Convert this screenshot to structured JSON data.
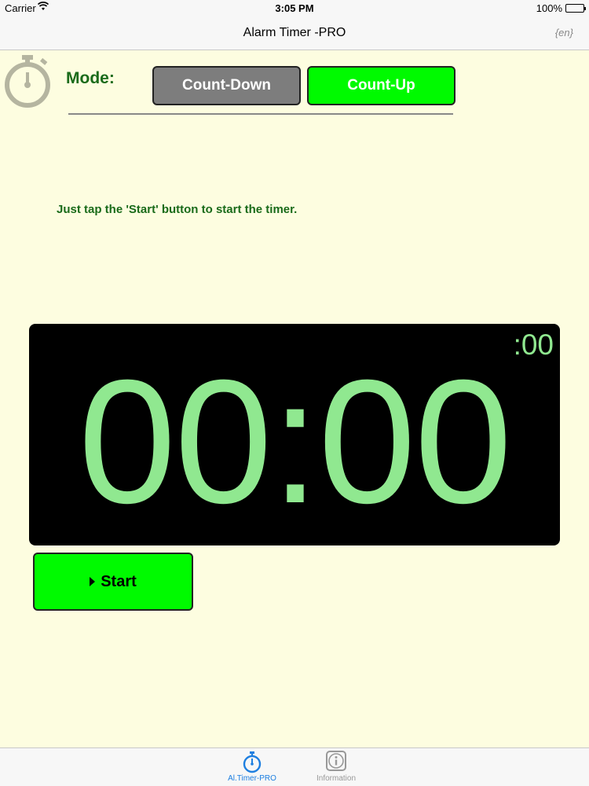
{
  "status_bar": {
    "carrier": "Carrier",
    "time": "3:05 PM",
    "battery": "100%"
  },
  "nav_bar": {
    "title": "Alarm Timer -PRO",
    "language": "{en}"
  },
  "mode": {
    "label": "Mode:",
    "options": [
      "Count-Down",
      "Count-Up"
    ],
    "selected": "Count-Up"
  },
  "instruction": "Just tap the 'Start' button to start the timer.",
  "timer": {
    "main": "00:00",
    "seconds": ":00"
  },
  "start_button": {
    "label": "Start"
  },
  "tab_bar": {
    "tabs": [
      {
        "label": "Al.Timer-PRO",
        "icon": "stopwatch-icon",
        "active": true
      },
      {
        "label": "Information",
        "icon": "info-icon",
        "active": false
      }
    ]
  },
  "colors": {
    "background": "#fdfde0",
    "accent_green": "#00fa00",
    "text_green": "#1a6b1a",
    "display_digits": "#90e890",
    "inactive_button": "#7d7d7d",
    "tab_active": "#1e7fe0"
  }
}
